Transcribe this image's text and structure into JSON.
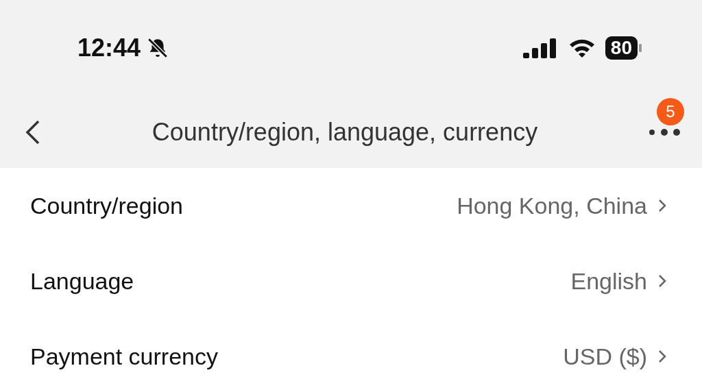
{
  "status_bar": {
    "time": "12:44",
    "battery": "80"
  },
  "header": {
    "title": "Country/region, language, currency",
    "badge": "5"
  },
  "rows": [
    {
      "label": "Country/region",
      "value": "Hong Kong, China"
    },
    {
      "label": "Language",
      "value": "English"
    },
    {
      "label": "Payment currency",
      "value": "USD ($)"
    }
  ]
}
